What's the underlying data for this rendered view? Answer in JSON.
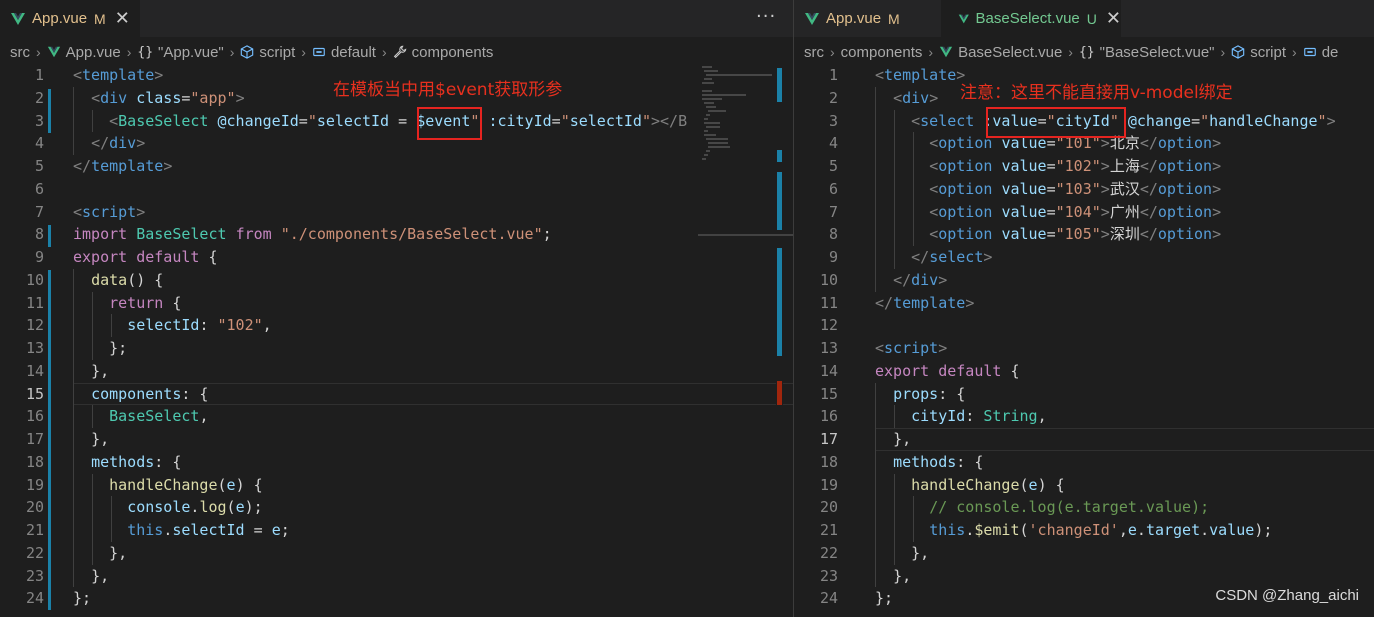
{
  "colors": {
    "vue_green": "#41b883",
    "annotation_red": "#e52420",
    "modified": "#e2c08d",
    "untracked": "#73c991"
  },
  "left": {
    "tabs": [
      {
        "name": "App.vue",
        "badge": "M",
        "icon": "vue-icon"
      }
    ],
    "more_actions": "···",
    "breadcrumb": {
      "folder": "src",
      "file": "App.vue",
      "component": "\"App.vue\"",
      "script": "script",
      "default": "default",
      "components": "components"
    },
    "annotation": "在模板当中用$event获取形参",
    "lines": [
      "1",
      "2",
      "3",
      "4",
      "5",
      "6",
      "7",
      "8",
      "9",
      "10",
      "11",
      "12",
      "13",
      "14",
      "15",
      "16",
      "17",
      "18",
      "19",
      "20",
      "21",
      "22",
      "23",
      "24"
    ],
    "current_line": "15"
  },
  "right": {
    "tabs": [
      {
        "name": "App.vue",
        "badge": "M",
        "icon": "vue-icon"
      },
      {
        "name": "BaseSelect.vue",
        "badge": "U",
        "icon": "vue-icon",
        "close": "✕"
      }
    ],
    "breadcrumb": {
      "folder": "src",
      "sub": "components",
      "file": "BaseSelect.vue",
      "component": "\"BaseSelect.vue\"",
      "script": "script",
      "default": "de"
    },
    "annotation": "注意：这里不能直接用v-model绑定",
    "lines": [
      "1",
      "2",
      "3",
      "4",
      "5",
      "6",
      "7",
      "8",
      "9",
      "10",
      "11",
      "12",
      "13",
      "14",
      "15",
      "16",
      "17",
      "18",
      "19",
      "20",
      "21",
      "22",
      "23",
      "24"
    ],
    "current_line": "17",
    "options": [
      {
        "value": "\"101\"",
        "label": "北京"
      },
      {
        "value": "\"102\"",
        "label": "上海"
      },
      {
        "value": "\"103\"",
        "label": "武汉"
      },
      {
        "value": "\"104\"",
        "label": "广州"
      },
      {
        "value": "\"105\"",
        "label": "深圳"
      }
    ]
  },
  "watermark": "CSDN @Zhang_aichi"
}
